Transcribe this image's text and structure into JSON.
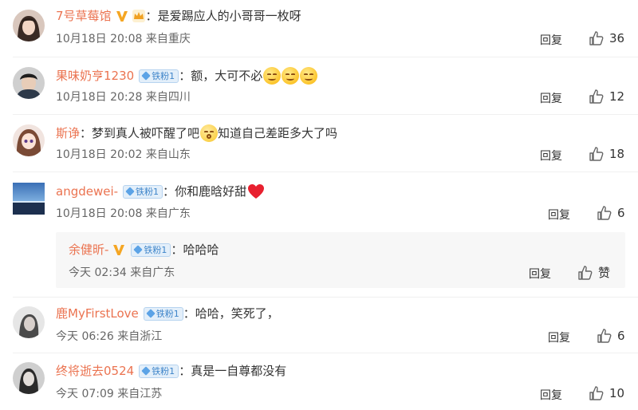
{
  "comments": [
    {
      "username": "7号草莓馆",
      "colon": "：",
      "text": "是爱踢应人的小哥哥一枚呀",
      "time": "10月18日 20:08",
      "location": "来自重庆",
      "reply_label": "回复",
      "likes": "36",
      "badges": [
        "v-badge-icon",
        "crown-icon"
      ]
    },
    {
      "username": "果味奶亨1230",
      "fan_badge": "铁粉1",
      "colon": "：",
      "text": "额，大可不必",
      "emojis": [
        "smile-emoji",
        "smile-emoji",
        "smile-emoji"
      ],
      "time": "10月18日 20:28",
      "location": "来自四川",
      "reply_label": "回复",
      "likes": "12"
    },
    {
      "username": "斯诤",
      "colon": "：",
      "text": "梦到真人被吓醒了吧",
      "text2": "知道自己差距多大了吗",
      "emojis": [
        "wow-emoji"
      ],
      "time": "10月18日 20:02",
      "location": "来自山东",
      "reply_label": "回复",
      "likes": "18"
    },
    {
      "username": "angdewei-",
      "fan_badge": "铁粉1",
      "colon": "：",
      "text": "你和鹿晗好甜",
      "emojis": [
        "heart-emoji"
      ],
      "time": "10月18日 20:08",
      "location": "来自广东",
      "reply_label": "回复",
      "likes": "6",
      "sub_reply": {
        "username": "余健昕-",
        "fan_badge": "铁粉1",
        "colon": "：",
        "text": "哈哈哈",
        "time": "今天 02:34",
        "location": "来自广东",
        "reply_label": "回复",
        "like_label": "赞"
      }
    },
    {
      "username": "鹿MyFirstLove",
      "fan_badge": "铁粉1",
      "colon": "：",
      "text": "哈哈，笑死了，",
      "time": "今天 06:26",
      "location": "来自浙江",
      "reply_label": "回复",
      "likes": "6"
    },
    {
      "username": "终将逝去0524",
      "fan_badge": "铁粉1",
      "colon": "：",
      "text": "真是一自尊都没有",
      "time": "今天 07:09",
      "location": "来自江苏",
      "reply_label": "回复",
      "likes": "10"
    }
  ],
  "colors": {
    "username": "#eb7350",
    "meta": "#666666",
    "fan_badge_bg": "#e3effa",
    "fan_badge_text": "#3d84c9"
  }
}
